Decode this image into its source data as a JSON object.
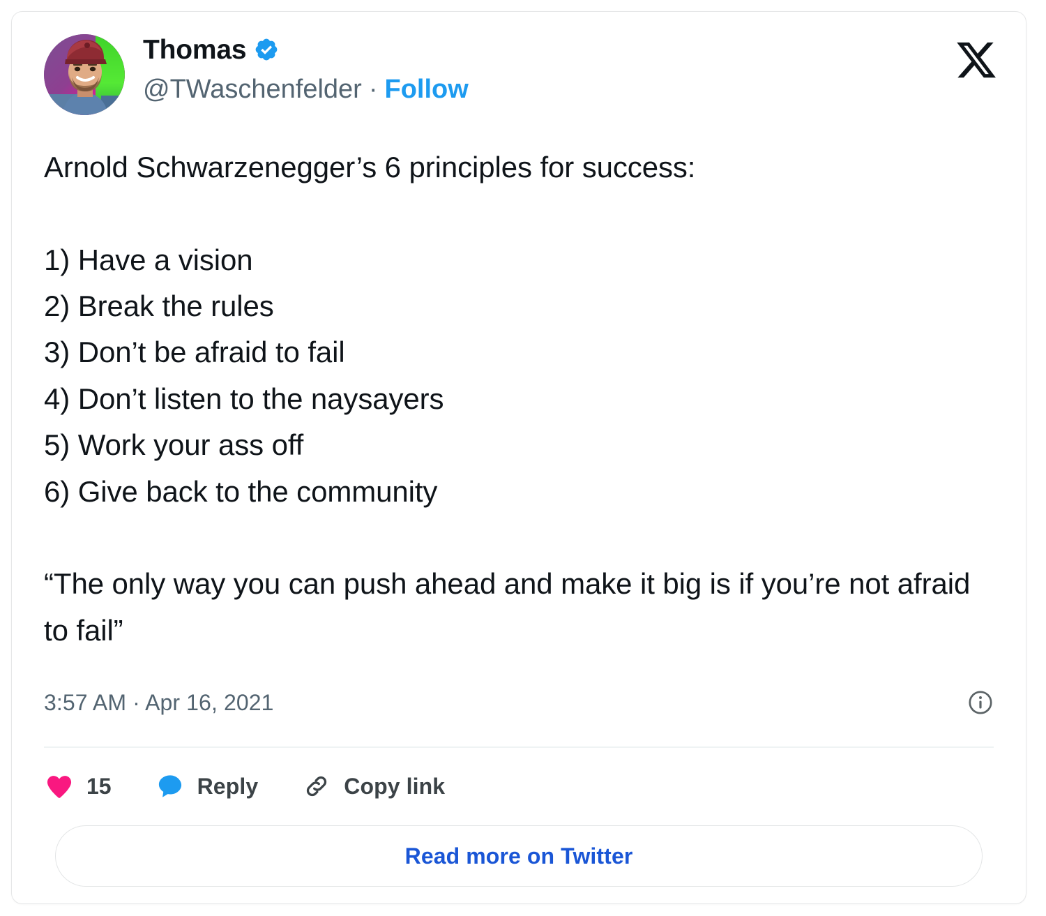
{
  "card": {
    "platform_logo": "x-logo",
    "background": "#ffffff",
    "border_color": "#e6e7e8"
  },
  "author": {
    "display_name": "Thomas",
    "verified": true,
    "verified_badge_color": "#1d9bf0",
    "handle": "@TWaschenfelder",
    "separator": "·",
    "follow_label": "Follow",
    "follow_color": "#1d9bf0",
    "avatar_alt": "avatar"
  },
  "tweet": {
    "text": "Arnold Schwarzenegger’s 6 principles for success:\n\n1) Have a vision\n2) Break the rules\n3) Don’t be afraid to fail\n4) Don’t listen to the naysayers\n5) Work your ass off\n6) Give back to the community\n\n“The only way you can push ahead and make it big is if you’re not afraid to fail”",
    "intro_line": "Arnold Schwarzenegger’s 6 principles for success:",
    "principles": [
      "1) Have a vision",
      "2) Break the rules",
      "3) Don’t be afraid to fail",
      "4) Don’t listen to the naysayers",
      "5) Work your ass off",
      "6) Give back to the community"
    ],
    "quote": "“The only way you can push ahead and make it big is if you’re not afraid to fail”",
    "time": "3:57 AM",
    "date": "Apr 16, 2021",
    "timestamp": "3:57 AM · Apr 16, 2021",
    "info_icon": "info-circle-icon"
  },
  "actions": {
    "like": {
      "icon": "heart-icon",
      "count": "15",
      "color": "#f91880"
    },
    "reply": {
      "icon": "speech-bubble-icon",
      "label": "Reply",
      "color": "#1d9bf0"
    },
    "copy_link": {
      "icon": "link-icon",
      "label": "Copy link",
      "color": "#3c4347"
    }
  },
  "footer": {
    "read_more_label": "Read more on Twitter",
    "read_more_color": "#1a56d6"
  }
}
